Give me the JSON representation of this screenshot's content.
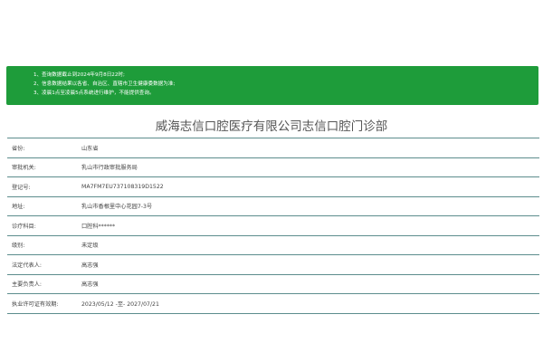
{
  "notice": {
    "lines": [
      {
        "num": "1、",
        "text": "查询数据截止到2024年9月8日22时;"
      },
      {
        "num": "2、",
        "text": "信息数据结果以各省、自治区、直辖市卫生健康委数据为准;"
      },
      {
        "num": "3、",
        "text": "凌晨1点至凌晨5点系统进行维护，不能提供查询。"
      }
    ]
  },
  "title": "威海志信口腔医疗有限公司志信口腔门诊部",
  "fields": [
    {
      "label": "省份:",
      "value": "山东省"
    },
    {
      "label": "审批机关:",
      "value": "乳山市行政审批服务局"
    },
    {
      "label": "登记号:",
      "value": "MA7FM7EU737108319D1522"
    },
    {
      "label": "地址:",
      "value": "乳山市香根里中心花园7-3号"
    },
    {
      "label": "诊疗科目:",
      "value": "口腔科******"
    },
    {
      "label": "级别:",
      "value": "未定级"
    },
    {
      "label": "法定代表人:",
      "value": "高志强"
    },
    {
      "label": "主要负责人:",
      "value": "高志强"
    },
    {
      "label": "执业许可证有效期:",
      "value": "2023/05/12 -至- 2027/07/21"
    }
  ]
}
